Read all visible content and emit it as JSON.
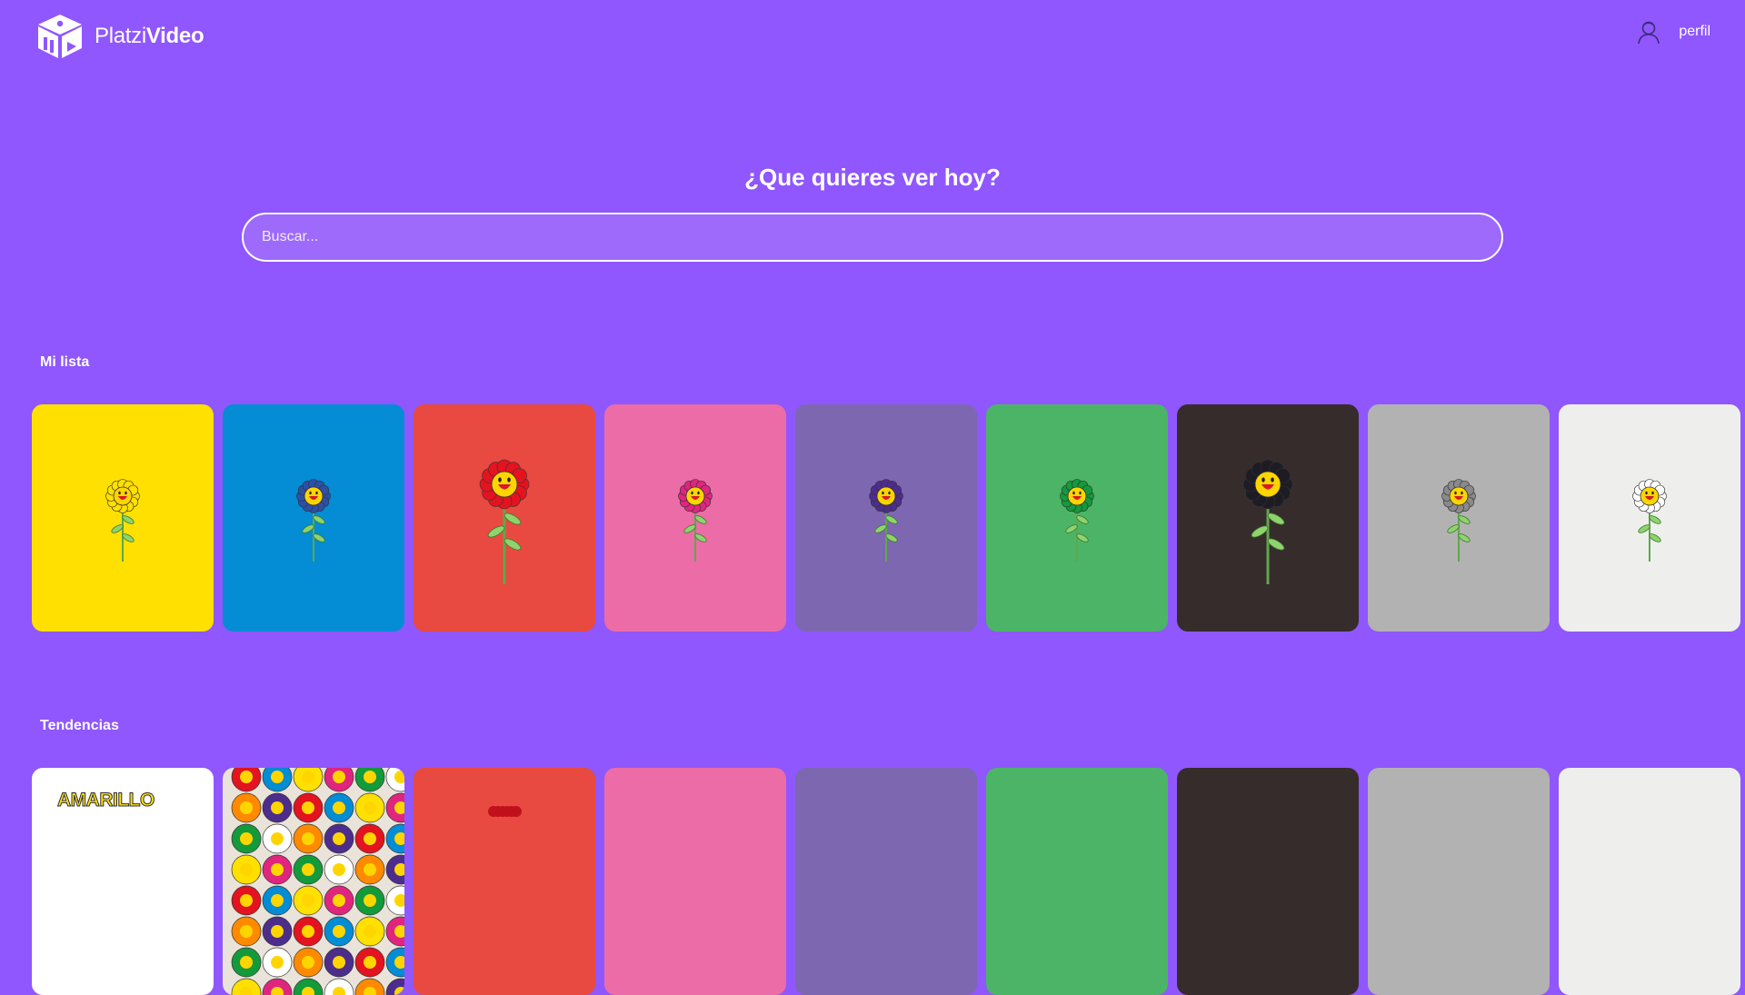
{
  "brand": {
    "part1": "Platzi",
    "part2": "Video"
  },
  "header": {
    "profile_label": "perfil"
  },
  "hero": {
    "title": "¿Que quieres ver hoy?",
    "search_placeholder": "Buscar..."
  },
  "sections": {
    "my_list": {
      "title": "Mi lista",
      "items": [
        {
          "bg": "#ffe000",
          "petal": "#ffe000",
          "center": "#ffd500",
          "size": "small"
        },
        {
          "bg": "#048cd4",
          "petal": "#2c4fa8",
          "center": "#ffd500",
          "size": "small"
        },
        {
          "bg": "#e84940",
          "petal": "#e3131f",
          "center": "#ffd500",
          "size": "large"
        },
        {
          "bg": "#ec6ca7",
          "petal": "#e0257f",
          "center": "#ffd500",
          "size": "small"
        },
        {
          "bg": "#7d67b1",
          "petal": "#4d2d8c",
          "center": "#ffd500",
          "size": "small"
        },
        {
          "bg": "#4cb466",
          "petal": "#139a3b",
          "center": "#ffd500",
          "size": "small"
        },
        {
          "bg": "#362c2c",
          "petal": "#1d1b24",
          "center": "#ffd500",
          "size": "large"
        },
        {
          "bg": "#b2b2b2",
          "petal": "#8a8a8a",
          "center": "#ffd500",
          "size": "small"
        },
        {
          "bg": "#eeefed",
          "petal": "#ffffff",
          "center": "#ffd500",
          "size": "small"
        }
      ]
    },
    "trending": {
      "title": "Tendencias",
      "first_card_text": "AMARILLO",
      "items": [
        {
          "bg": "#ffffff"
        },
        {
          "bg": "#e9e3d9"
        },
        {
          "bg": "#e84940"
        },
        {
          "bg": "#ec6ca7"
        },
        {
          "bg": "#7d67b1"
        },
        {
          "bg": "#4cb466"
        },
        {
          "bg": "#362c2c"
        },
        {
          "bg": "#b2b2b2"
        },
        {
          "bg": "#eeefed"
        }
      ]
    }
  },
  "colors": {
    "background": "#8f57fd",
    "search_bg": "#9d6afb",
    "text": "#ffffff"
  }
}
